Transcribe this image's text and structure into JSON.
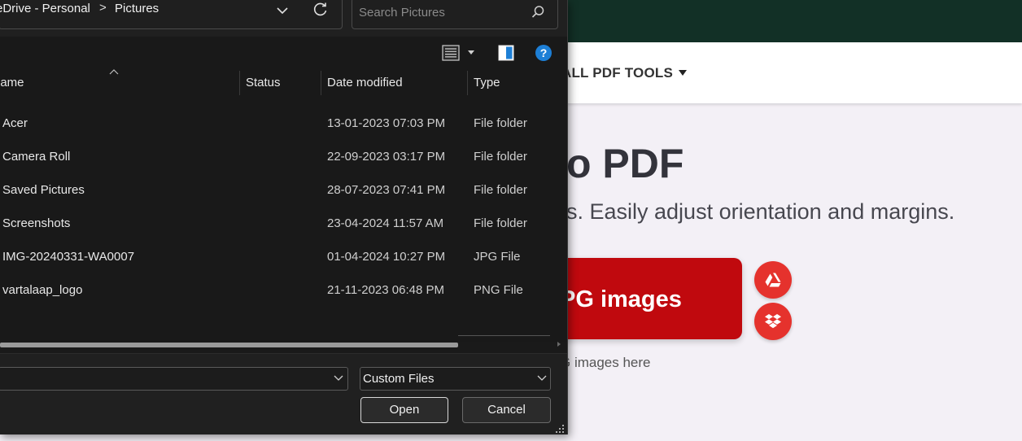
{
  "webpage": {
    "nav_all_tools": "ALL PDF TOOLS",
    "title_fragment": "o PDF",
    "subtitle_fragment": "s. Easily adjust orientation and margins.",
    "select_button_fragment": "PG images",
    "drop_hint_fragment": "G images here",
    "colors": {
      "topbar": "#123026",
      "brand_red": "#e5322d",
      "button_red": "#c0090e"
    }
  },
  "dialog": {
    "breadcrumb": [
      "eDrive - Personal",
      "Pictures"
    ],
    "breadcrumb_separator": ">",
    "search_placeholder": "Search Pictures",
    "help_glyph": "?",
    "columns": {
      "name": "Name",
      "status": "Status",
      "date": "Date modified",
      "type": "Type"
    },
    "name_column_visible": "lame",
    "files": [
      {
        "name": "Acer",
        "status": "",
        "date": "13-01-2023 07:03 PM",
        "type": "File folder"
      },
      {
        "name": "Camera Roll",
        "status": "",
        "date": "22-09-2023 03:17 PM",
        "type": "File folder"
      },
      {
        "name": "Saved Pictures",
        "status": "",
        "date": "28-07-2023 07:41 PM",
        "type": "File folder"
      },
      {
        "name": "Screenshots",
        "status": "",
        "date": "23-04-2024 11:57 AM",
        "type": "File folder"
      },
      {
        "name": "IMG-20240331-WA0007",
        "status": "",
        "date": "01-04-2024 10:27 PM",
        "type": "JPG File"
      },
      {
        "name": "vartalaap_logo",
        "status": "",
        "date": "21-11-2023 06:48 PM",
        "type": "PNG File"
      }
    ],
    "file_name_value": "",
    "file_type_filter": "Custom Files",
    "open_label": "Open",
    "cancel_label": "Cancel"
  }
}
